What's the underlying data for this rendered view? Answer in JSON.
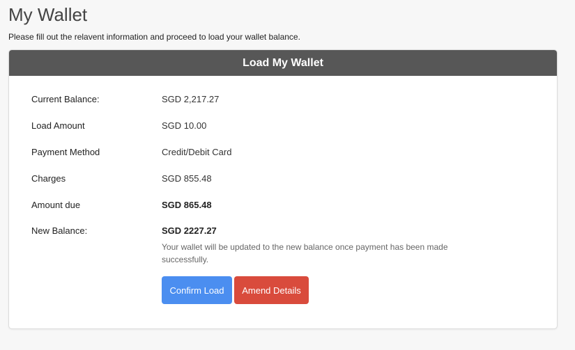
{
  "page": {
    "title": "My Wallet",
    "subtitle": "Please fill out the relavent information and proceed to load your wallet balance."
  },
  "card": {
    "header": "Load My Wallet",
    "rows": [
      {
        "label": "Current Balance:",
        "value": "SGD 2,217.27"
      },
      {
        "label": "Load Amount",
        "value": "SGD 10.00"
      },
      {
        "label": "Payment Method",
        "value": "Credit/Debit Card"
      },
      {
        "label": "Charges",
        "value": "SGD 855.48"
      },
      {
        "label": "Amount due",
        "value": "SGD 865.48"
      },
      {
        "label": "New Balance:",
        "value": "SGD 2227.27"
      }
    ],
    "note": "Your wallet will be updated to the new balance once payment has been made successfully.",
    "buttons": {
      "confirm": "Confirm Load",
      "amend": "Amend Details"
    }
  },
  "colors": {
    "header_bg": "#575757",
    "confirm_button": "#4b8ef0",
    "amend_button": "#d94b3c"
  }
}
